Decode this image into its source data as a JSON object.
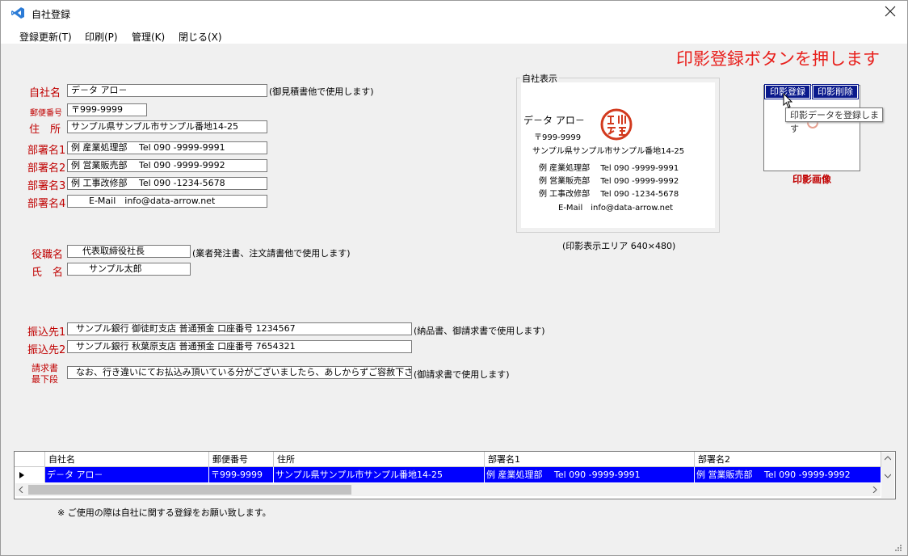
{
  "window": {
    "title": "自社登録"
  },
  "menu": [
    "登録更新(T)",
    "印刷(P)",
    "管理(K)",
    "閉じる(X)"
  ],
  "hint": "印影登録ボタンを押します",
  "form": {
    "company": {
      "label": "自社名",
      "value": "デ－タ アロ－",
      "note": "(御見積書他で使用します)"
    },
    "postal": {
      "label": "郵便番号",
      "value": "〒999-9999"
    },
    "address": {
      "label": "住　所",
      "value": "サンプル県サンプル市サンプル番地14-25"
    },
    "dept1": {
      "label": "部署名1",
      "value": "例 産業処理部　 Tel 090 -9999-9991"
    },
    "dept2": {
      "label": "部署名2",
      "value": "例 営業販売部　 Tel 090 -9999-9992"
    },
    "dept3": {
      "label": "部署名3",
      "value": "例 工事改修部　 Tel 090 -1234-5678"
    },
    "dept4": {
      "label": "部署名4",
      "value": "E-Mail　info@data-arrow.net"
    },
    "position": {
      "label": "役職名",
      "value": "代表取締役社長",
      "note": "(業者発注書、注文請書他で使用します)"
    },
    "name": {
      "label": "氏　名",
      "value": "サンプル太郎"
    },
    "bank1": {
      "label": "振込先1",
      "value": "サンプル銀行 御徒町支店 普通預金 口座番号 1234567",
      "note": "(納品書、御請求書で使用します)"
    },
    "bank2": {
      "label": "振込先2",
      "value": "サンプル銀行 秋葉原支店 普通預金 口座番号 7654321"
    },
    "invoice_footer": {
      "label_line1": "請求書",
      "label_line2": "最下段",
      "value": "なお、行き違いにてお払込み頂いている分がございましたら、あしからずご容赦下さい。",
      "note": "(御請求書で使用します)"
    }
  },
  "preview": {
    "group_title": "自社表示",
    "company": "デ－タ アロ－",
    "postal": "〒999-9999",
    "address": "サンプル県サンプル市サンプル番地14-25",
    "dept1": "例 産業処理部　 Tel 090 -9999-9991",
    "dept2": "例 営業販売部　 Tel 090 -9999-9992",
    "dept3": "例 工事改修部　 Tel 090 -1234-5678",
    "email": "E-Mail　info@data-arrow.net",
    "area_caption": "(印影表示エリア 640×480)",
    "seal_icon": "hanko-seal-icon",
    "seal_color": "#d23a1e"
  },
  "stamp": {
    "register_button": "印影登録",
    "delete_button": "印影削除",
    "tooltip": "印影データを登録します",
    "caption": "印影画像"
  },
  "grid": {
    "columns": [
      "自社名",
      "郵便番号",
      "住所",
      "部署名1",
      "部署名2"
    ],
    "rows": [
      [
        "デ－タ アロ－",
        "〒999-9999",
        "サンプル県サンプル市サンプル番地14-25",
        "例 産業処理部　 Tel 090 -9999-9991",
        "例 営業販売部　 Tel 090 -9999-9992"
      ]
    ]
  },
  "footer_note": "※ ご使用の際は自社に関する登録をお願い致します。",
  "colors": {
    "label_red": "#c00000",
    "hint_red": "#e8201c",
    "selection_blue": "#0000ff",
    "button_navy": "#0a1a8c"
  }
}
